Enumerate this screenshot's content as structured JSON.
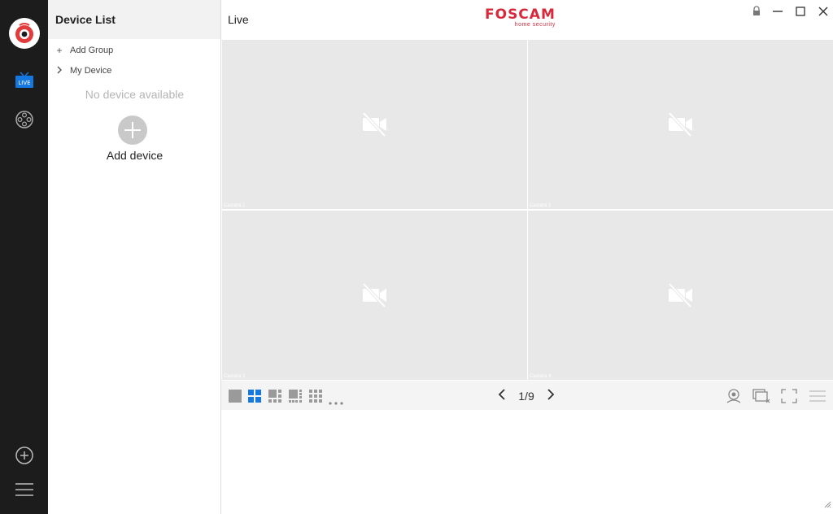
{
  "sidebar": {
    "icons": [
      "app-logo-icon",
      "live-icon",
      "playback-icon",
      "add-icon",
      "menu-icon"
    ],
    "live_badge": "LIVE"
  },
  "device_panel": {
    "title": "Device List",
    "add_group_label": "Add Group",
    "my_device_label": "My Device",
    "empty_text": "No device available",
    "add_device_label": "Add device"
  },
  "main": {
    "title": "Live",
    "brand_name": "FOSCAM",
    "brand_tagline": "home security",
    "cameras": [
      {
        "label": "Camera 1"
      },
      {
        "label": "Camera 2"
      },
      {
        "label": "Camera 3"
      },
      {
        "label": "Camera 4"
      }
    ],
    "pager": "1/9",
    "selected_layout": "4-split",
    "accent_color": "#1478e0",
    "brand_color": "#d6293b"
  }
}
